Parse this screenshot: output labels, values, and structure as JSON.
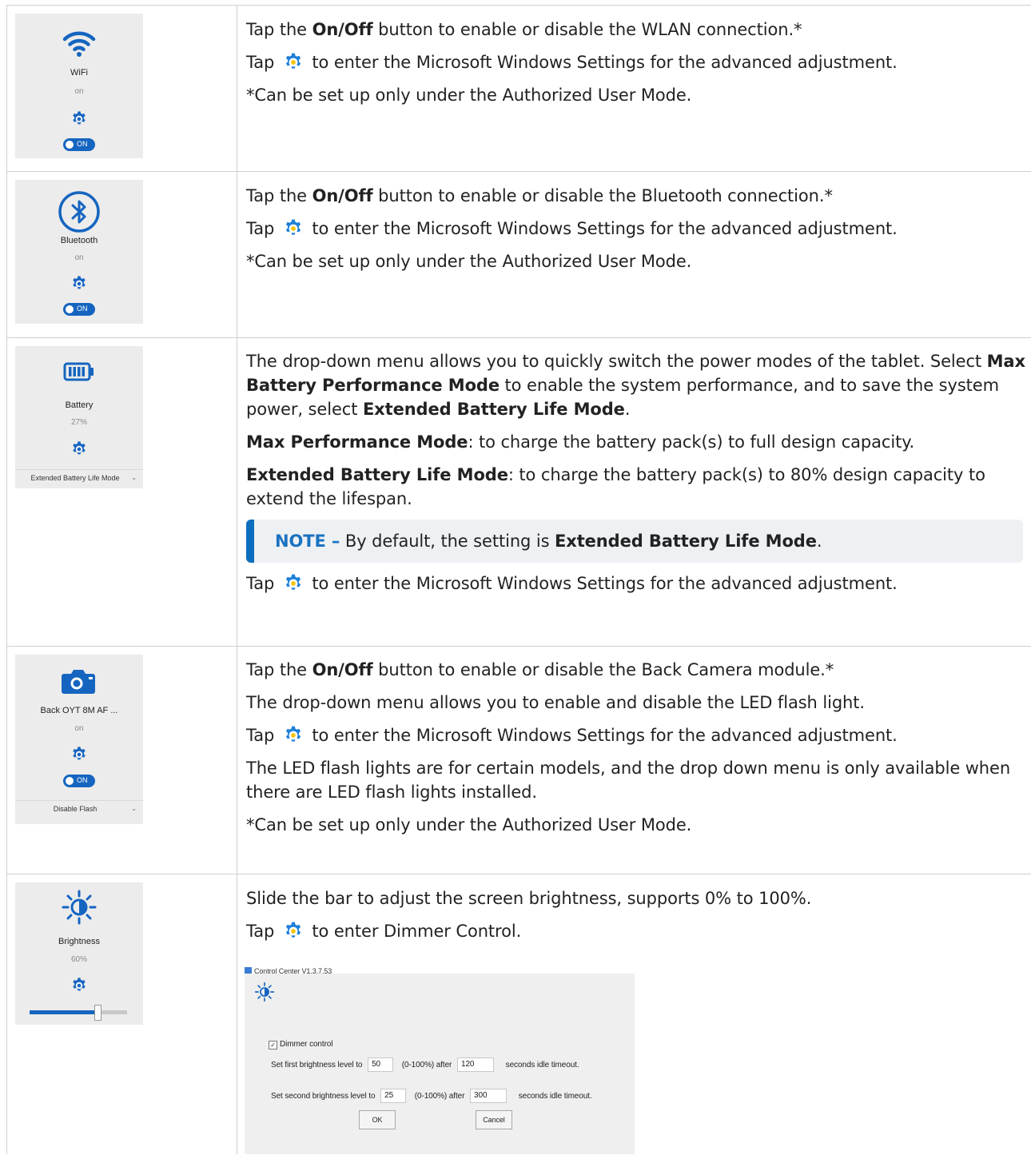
{
  "rows": {
    "wifi": {
      "tile": {
        "name": "WiFi",
        "status": "on",
        "toggle": "ON"
      },
      "lines": {
        "l1_a": "Tap the ",
        "l1_b": "On/Off",
        "l1_c": " button to enable or disable the WLAN connection.*",
        "l2_a": "Tap ",
        "l2_b": " to enter the Microsoft Windows Settings for the advanced adjustment.",
        "l3": "*Can be set up only under the Authorized User Mode."
      }
    },
    "bluetooth": {
      "tile": {
        "name": "Bluetooth",
        "status": "on",
        "toggle": "ON"
      },
      "lines": {
        "l1_a": "Tap the ",
        "l1_b": "On/Off",
        "l1_c": " button to enable or disable the Bluetooth connection.*",
        "l2_a": "Tap ",
        "l2_b": " to enter the Microsoft Windows Settings for the advanced adjustment.",
        "l3": "*Can be set up only under the Authorized User Mode."
      }
    },
    "battery": {
      "tile": {
        "name": "Battery",
        "status": "27%",
        "dropdown": "Extended Battery Life Mode"
      },
      "lines": {
        "p1_a": "The drop-down menu allows you to quickly switch the power modes of the tablet. Select ",
        "p1_b": "Max Battery Performance Mode",
        "p1_c": " to enable the system performance, and to save the system power, select ",
        "p1_d": "Extended Battery Life Mode",
        "p1_e": ".",
        "p2_a": "Max Performance Mode",
        "p2_b": ": to charge the battery pack(s) to full design capacity.",
        "p3_a": "Extended Battery Life Mode",
        "p3_b": ": to charge the battery pack(s) to 80% design capacity to extend the lifespan.",
        "note_label": "NOTE –",
        "note_a": " By default, the setting is ",
        "note_b": "Extended Battery Life Mode",
        "note_c": ".",
        "l_tap_a": "Tap ",
        "l_tap_b": " to enter the Microsoft Windows Settings for the advanced adjustment."
      }
    },
    "camera": {
      "tile": {
        "name": "Back OYT 8M AF ...",
        "status": "on",
        "toggle": "ON",
        "dropdown": "Disable Flash"
      },
      "lines": {
        "l1_a": "Tap the ",
        "l1_b": "On/Off",
        "l1_c": " button to enable or disable the Back Camera module.*",
        "l2": "The drop-down menu allows you to enable and disable the LED flash light.",
        "l3_a": "Tap ",
        "l3_b": " to enter the Microsoft Windows Settings for the advanced adjustment.",
        "l4": " The LED flash lights are for certain models, and the drop down menu is only available when there are LED flash lights installed.",
        "l5": "*Can be set up only under the Authorized User Mode."
      }
    },
    "brightness": {
      "tile": {
        "name": "Brightness",
        "status": "60%",
        "level": 0.6
      },
      "lines": {
        "l1": "Slide the bar to adjust the screen brightness, supports 0% to 100%.",
        "l2_a": "Tap ",
        "l2_b": " to enter Dimmer Control."
      },
      "dimmer": {
        "window_title": "Control Center V1.3.7.53",
        "checkbox_label": "Dimmer control",
        "first_a": "Set first brightness level to",
        "first_level": "50",
        "first_b": "(0-100%) after",
        "first_secs": "120",
        "first_c": "seconds idle timeout.",
        "second_a": "Set second brightness level to",
        "second_level": "25",
        "second_b": "(0-100%) after",
        "second_secs": "300",
        "second_c": "seconds idle timeout.",
        "ok": "OK",
        "cancel": "Cancel"
      }
    }
  },
  "colors": {
    "accent": "#1565c0",
    "tile_bg": "#ececec",
    "note_bar": "#0d6ebd",
    "note_bg": "#eef1f4"
  }
}
